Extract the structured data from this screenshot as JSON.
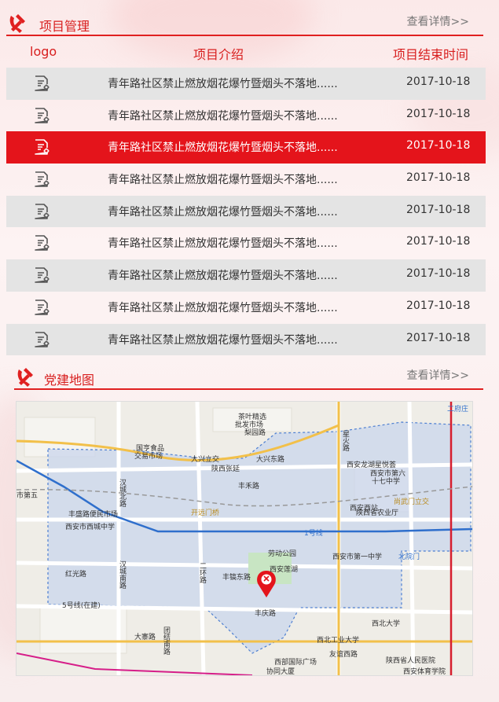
{
  "project_section": {
    "title": "项目管理",
    "more_link": "查看详情>>",
    "columns": {
      "logo": "logo",
      "intro": "项目介绍",
      "end_time": "项目结束时间"
    },
    "rows": [
      {
        "title": "青年路社区禁止燃放烟花爆竹暨烟头不落地......",
        "date": "2017-10-18"
      },
      {
        "title": "青年路社区禁止燃放烟花爆竹暨烟头不落地......",
        "date": "2017-10-18"
      },
      {
        "title": "青年路社区禁止燃放烟花爆竹暨烟头不落地......",
        "date": "2017-10-18"
      },
      {
        "title": "青年路社区禁止燃放烟花爆竹暨烟头不落地......",
        "date": "2017-10-18"
      },
      {
        "title": "青年路社区禁止燃放烟花爆竹暨烟头不落地......",
        "date": "2017-10-18"
      },
      {
        "title": "青年路社区禁止燃放烟花爆竹暨烟头不落地......",
        "date": "2017-10-18"
      },
      {
        "title": "青年路社区禁止燃放烟花爆竹暨烟头不落地......",
        "date": "2017-10-18"
      },
      {
        "title": "青年路社区禁止燃放烟花爆竹暨烟头不落地......",
        "date": "2017-10-18"
      },
      {
        "title": "青年路社区禁止燃放烟花爆竹暨烟头不落地......",
        "date": "2017-10-18"
      }
    ],
    "active_row_index": 2,
    "colors": {
      "accent": "#e4141b",
      "stripe": "#e4e4e4"
    }
  },
  "map_section": {
    "title": "党建地图",
    "more_link": "查看详情>>",
    "map_labels": {
      "l1": "茶叶精选",
      "l2": "批发市场",
      "l3": "梨园路",
      "l4": "二府庄",
      "l5": "国亨食品",
      "l6": "交易市场",
      "l7": "大兴立交",
      "l8": "大兴东路",
      "l9": "西安龙湖星悦荟",
      "l10": "陕西张延",
      "l11": "丰禾路",
      "l12": "西安市第六",
      "l13": "十七中学",
      "l14": "西安市西城中学",
      "l15": "丰盛路便民市场",
      "l16": "开远门桥",
      "l17": "劳动公园",
      "l18": "西安西站",
      "l19": "尚武门立交",
      "l20": "陕西省农业厅",
      "l21": "西安市第一中学",
      "l22": "北院门",
      "l23": "红光路",
      "l24": "丰镐东路",
      "l25": "西安莲湖",
      "l26": "丰庆路",
      "l27": "大寨路",
      "l28": "西北大学",
      "l29": "西北工业大学",
      "l30": "友谊西路",
      "l31": "陕西省人民医院",
      "l32": "西安体育学院",
      "l33": "协同大厦",
      "l34": "西部国际广场",
      "l35": "1号线",
      "l36": "5号线(在建)",
      "l37": "汉城北路",
      "l38": "汉城南路",
      "l39": "二环路",
      "l40": "星火路",
      "l41": "团结南路",
      "l42": "市第五",
      "l43": "西安市西城中学"
    },
    "marker": "party-marker"
  }
}
